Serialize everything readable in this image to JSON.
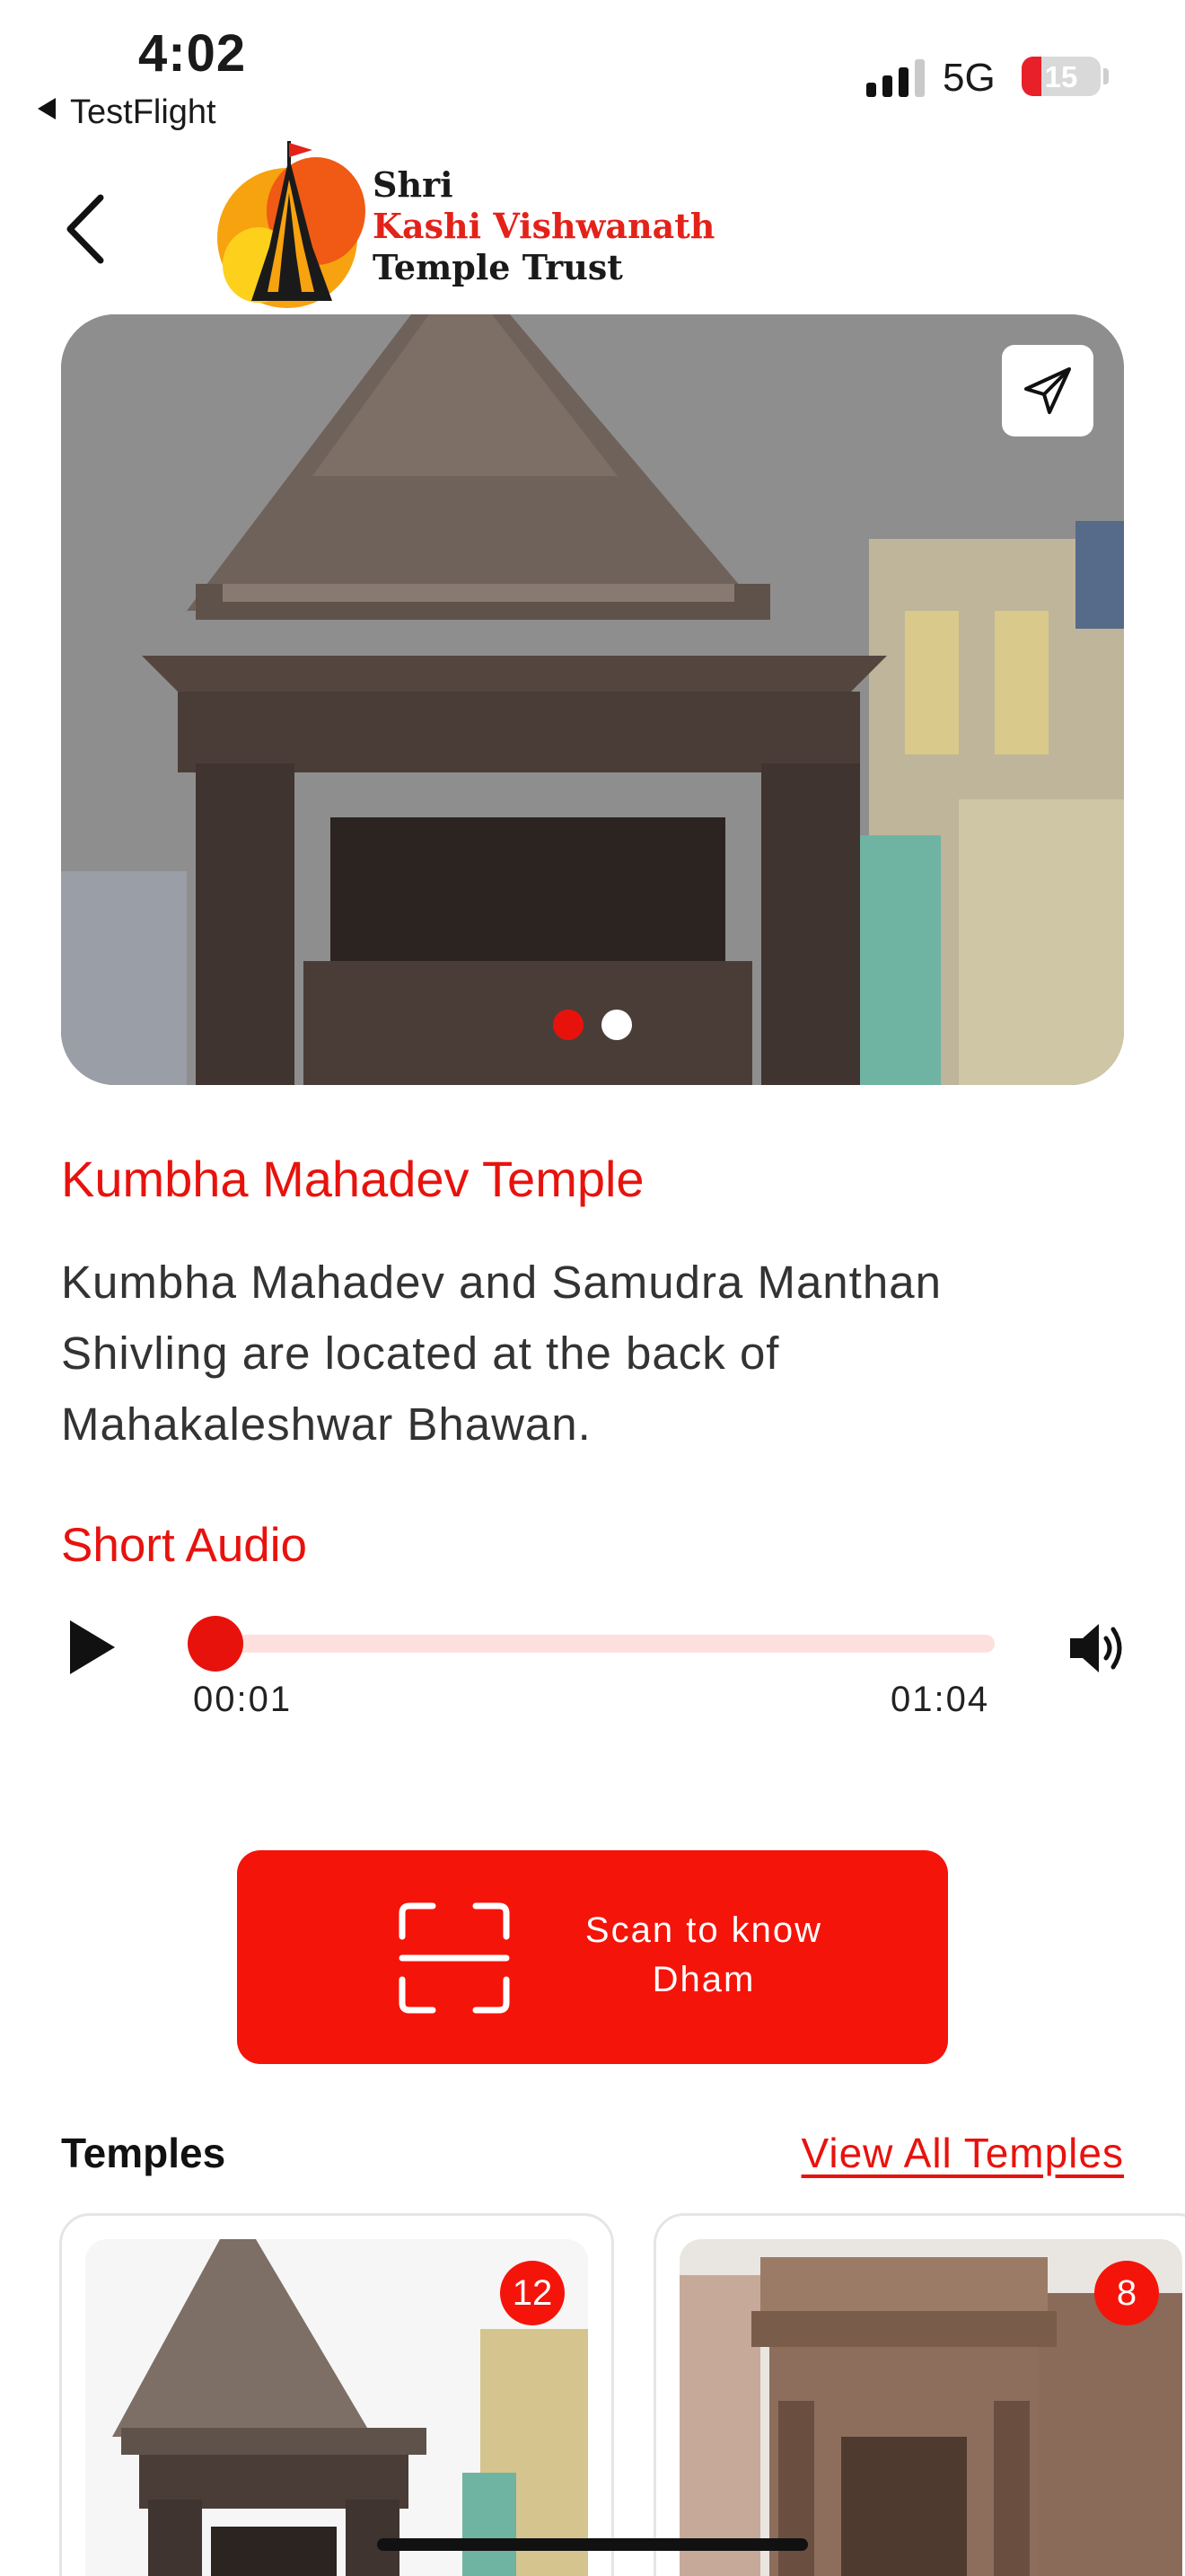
{
  "status_bar": {
    "time": "4:02",
    "back_app": "TestFlight",
    "network": "5G",
    "battery": "15"
  },
  "header": {
    "logo_line1": "Shri",
    "logo_line2": "Kashi Vishwanath",
    "logo_line3": "Temple Trust",
    "back_icon": "chevron-left-icon"
  },
  "hero": {
    "share_icon": "paper-plane-icon",
    "slides": 2,
    "active_slide": 1
  },
  "detail": {
    "title": "Kumbha Mahadev Temple",
    "description": "Kumbha Mahadev and Samudra Manthan Shivling are located at the back of Mahakaleshwar Bhawan."
  },
  "audio": {
    "section_title": "Short Audio",
    "current_time": "00:01",
    "duration": "01:04",
    "progress_fraction": 0.016,
    "play_icon": "play-icon",
    "volume_icon": "speaker-icon"
  },
  "scan": {
    "label": "Scan to know Dham",
    "icon": "scan-frame-icon"
  },
  "temples": {
    "section_title": "Temples",
    "view_all": "View All Temples",
    "cards": [
      {
        "badge": "12"
      },
      {
        "badge": "8"
      }
    ]
  },
  "colors": {
    "accent": "#e8120d",
    "button": "#f5140a",
    "track": "#fde0dd"
  }
}
